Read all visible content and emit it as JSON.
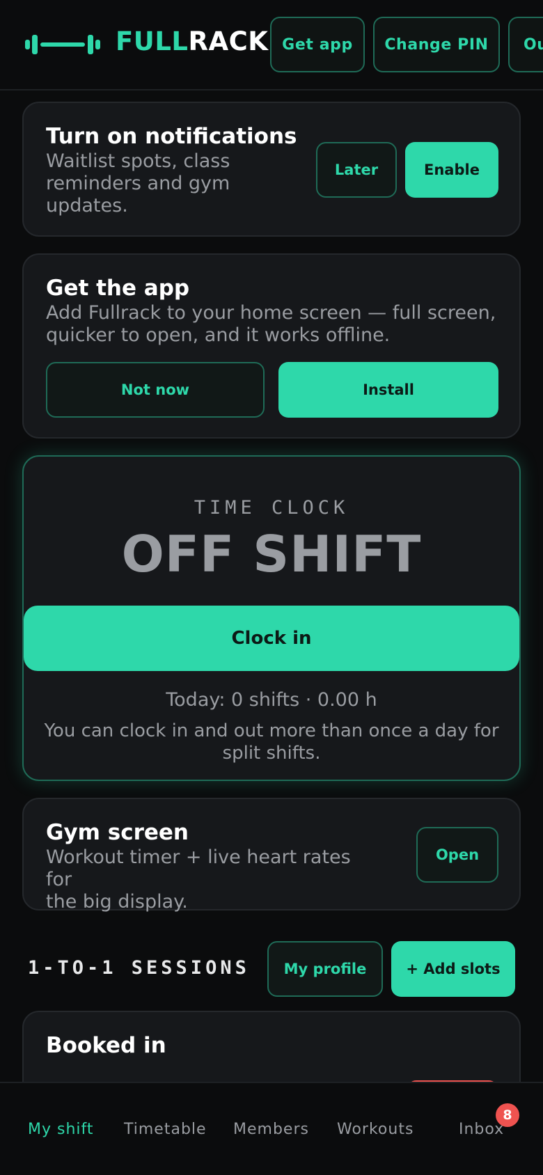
{
  "colors": {
    "accent": "#2ed8aa",
    "background": "#0b0c0d",
    "card": "#16181b",
    "muted_text": "#9a9da2",
    "badge": "#ef5350"
  },
  "header": {
    "logo_icon": "barbell-icon",
    "brand_part1": "FULL",
    "brand_part2": "RACK",
    "buttons": [
      "Get app",
      "Change PIN",
      "Out"
    ]
  },
  "notifications_card": {
    "title": "Turn on notifications",
    "subtitle_lines": [
      "Waitlist spots, class",
      "reminders and gym",
      "updates."
    ],
    "later_label": "Later",
    "enable_label": "Enable"
  },
  "app_card": {
    "title": "Get the app",
    "subtitle_lines": [
      "Add Fullrack to your home screen — full screen,",
      "quicker to open, and it works offline."
    ],
    "not_now_label": "Not now",
    "install_label": "Install"
  },
  "time_clock": {
    "label": "TIME CLOCK",
    "status": "OFF SHIFT",
    "button_label": "Clock in",
    "today": "Today: 0 shifts · 0.00 h",
    "note_lines": [
      "You can clock in and out more than once a day for",
      "split shifts."
    ]
  },
  "gym_screen_card": {
    "title": "Gym screen",
    "subtitle_lines": [
      "Workout timer + live heart rates for",
      "the big display."
    ],
    "open_label": "Open"
  },
  "sessions": {
    "heading": "1-TO-1 SESSIONS",
    "profile_label": "My profile",
    "add_slots_label": "+ Add slots",
    "booked_title": "Booked in"
  },
  "bottom_nav": {
    "items": [
      "My shift",
      "Timetable",
      "Members",
      "Workouts",
      "Inbox"
    ],
    "active": "My shift",
    "inbox_badge": "8"
  }
}
